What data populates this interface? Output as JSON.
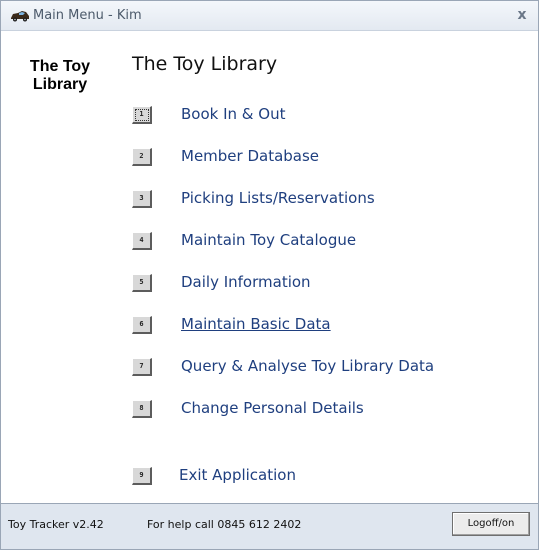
{
  "window": {
    "title": "Main Menu - Kim",
    "close_glyph": "x",
    "icon": "toy-car-icon"
  },
  "side_title": {
    "line1": "The Toy",
    "line2": "Library"
  },
  "main_title": "The Toy Library",
  "menu": {
    "items": [
      {
        "number": "1",
        "label": "Book In & Out"
      },
      {
        "number": "2",
        "label": "Member Database"
      },
      {
        "number": "3",
        "label": "Picking Lists/Reservations"
      },
      {
        "number": "4",
        "label": "Maintain Toy Catalogue"
      },
      {
        "number": "5",
        "label": "Daily Information"
      },
      {
        "number": "6",
        "label": "Maintain Basic Data"
      },
      {
        "number": "7",
        "label": "Query & Analyse Toy Library Data"
      },
      {
        "number": "8",
        "label": "Change Personal Details"
      },
      {
        "number": "9",
        "label": "Exit Application"
      }
    ]
  },
  "status": {
    "version": "Toy Tracker v2.42",
    "help": "For help call 0845 612 2402",
    "logoff_label": "Logoff/on"
  },
  "colors": {
    "menu_text": "#1f3f7f",
    "titlebar": "#e3e9f1",
    "statusbar": "#dfe6ef"
  }
}
